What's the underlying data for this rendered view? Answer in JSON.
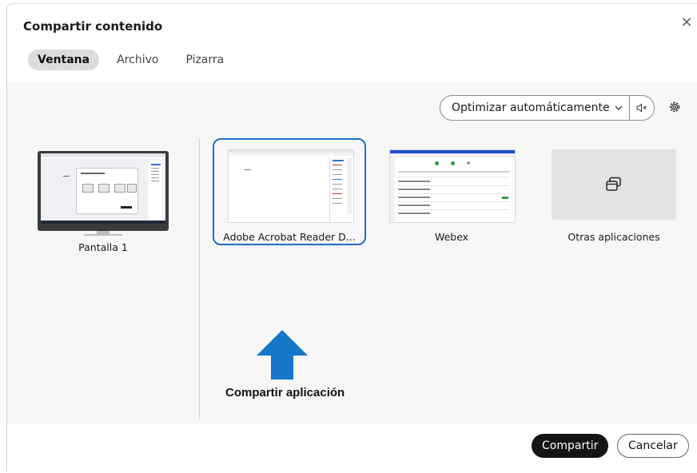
{
  "dialog": {
    "title": "Compartir contenido",
    "close_glyph": "×"
  },
  "tabs": [
    {
      "label": "Ventana",
      "active": true
    },
    {
      "label": "Archivo",
      "active": false
    },
    {
      "label": "Pizarra",
      "active": false
    }
  ],
  "toolbar": {
    "optimize_label": "Optimizar automáticamente",
    "optimize_icon": "chevron-down-icon",
    "mute_icon": "speaker-mute-icon",
    "settings_icon": "gear-icon"
  },
  "sources": {
    "screen": {
      "label": "Pantalla 1"
    },
    "selected_app": {
      "label": "Adobe Acrobat Reader D..."
    },
    "webex": {
      "label": "Webex"
    },
    "other_apps": {
      "label": "Otras aplicaciones",
      "icon": "windows-stack-icon"
    }
  },
  "annotation": {
    "text": "Compartir aplicación",
    "arrow_color": "#1577c9"
  },
  "footer": {
    "share_label": "Compartir",
    "cancel_label": "Cancelar"
  },
  "colors": {
    "accent": "#1f6fc4",
    "primary_button": "#141414",
    "panel": "#f7f7f7"
  }
}
